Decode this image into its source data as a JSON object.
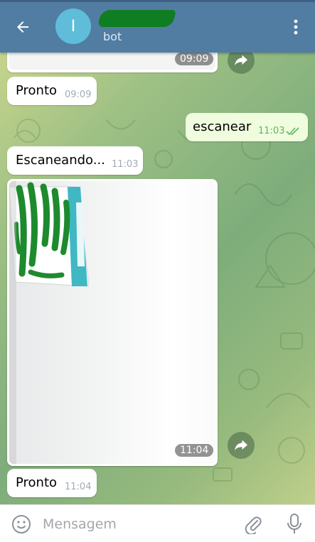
{
  "header": {
    "avatar_initial": "I",
    "contact_name": "",
    "status": "bot"
  },
  "messages": [
    {
      "type": "image",
      "direction": "incoming",
      "time": "09:09",
      "partial": true
    },
    {
      "type": "text",
      "direction": "incoming",
      "text": "Pronto",
      "time": "09:09"
    },
    {
      "type": "text",
      "direction": "outgoing",
      "text": "escanear",
      "time": "11:03",
      "read": true
    },
    {
      "type": "text",
      "direction": "incoming",
      "text": "Escaneando...",
      "time": "11:03"
    },
    {
      "type": "image",
      "direction": "incoming",
      "time": "11:04"
    },
    {
      "type": "text",
      "direction": "incoming",
      "text": "Pronto",
      "time": "11:04"
    }
  ],
  "composer": {
    "placeholder": "Mensagem"
  },
  "colors": {
    "header_bg": "#517da2",
    "outgoing_bubble": "#effdde",
    "incoming_bubble": "#ffffff",
    "read_check": "#5fb65f",
    "time_gray": "#a0acb6"
  },
  "icons": [
    "back-arrow-icon",
    "more-vertical-icon",
    "share-icon",
    "double-check-icon",
    "emoji-icon",
    "paperclip-icon",
    "microphone-icon"
  ]
}
